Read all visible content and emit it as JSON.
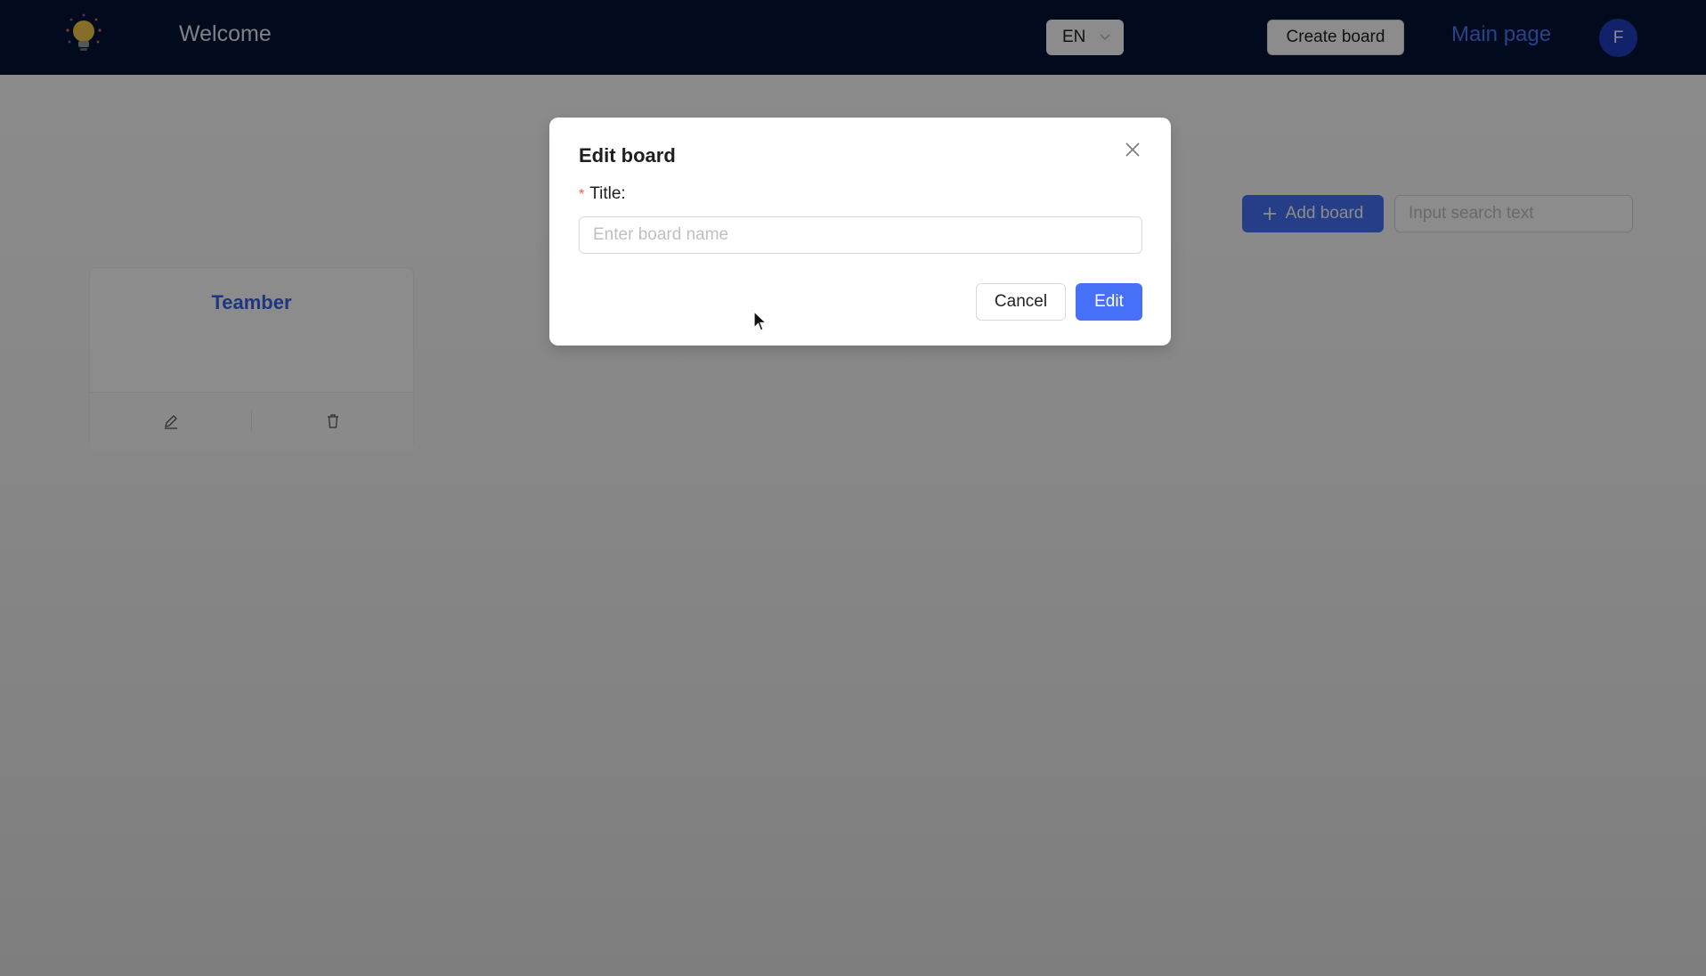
{
  "header": {
    "welcome_text": "Welcome",
    "language": "EN",
    "create_board_label": "Create board",
    "main_page_label": "Main page",
    "avatar_initial": "F"
  },
  "toolbar": {
    "add_board_label": "Add board",
    "search_placeholder": "Input search text"
  },
  "boards": [
    {
      "title": "Teamber"
    }
  ],
  "modal": {
    "title": "Edit board",
    "field_label": "Title:",
    "required_mark": "*",
    "input_placeholder": "Enter board name",
    "cancel_label": "Cancel",
    "submit_label": "Edit"
  },
  "colors": {
    "header_bg": "#041537",
    "primary": "#4670f7",
    "link": "#4a78ff",
    "avatar_bg": "#1f3fc4",
    "card_title": "#3a62e8",
    "required": "#ff4d4f"
  },
  "icons": {
    "logo": "lightbulb-icon",
    "language_dropdown": "chevron-down-icon",
    "add": "plus-icon",
    "edit": "pencil-icon",
    "delete": "trash-icon",
    "close": "close-icon",
    "pointer": "mouse-cursor-icon"
  }
}
